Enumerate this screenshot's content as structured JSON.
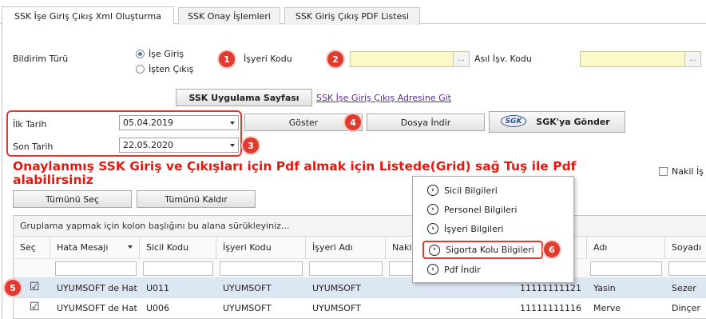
{
  "tabs": [
    {
      "label": "SSK İşe Giriş Çıkış Xml Oluşturma",
      "active": true
    },
    {
      "label": "SSK Onay İşlemleri",
      "active": false
    },
    {
      "label": "SSK Giriş Çıkış PDF Listesi",
      "active": false
    }
  ],
  "form": {
    "bildirim_label": "Bildirim Türü",
    "radio_ise_giris": "İşe Giriş",
    "radio_isten_cikis": "İşten Çıkış",
    "isyeri_kodu_label": "İşyeri Kodu",
    "asil_isv_kodu_label": "Asıl İşv. Kodu",
    "ellipsis": "...",
    "ssk_uygulama_button": "SSK Uygulama Sayfası",
    "ssk_adres_link": "SSK İşe Giriş Çıkış Adresine Git",
    "ilk_tarih_label": "İlk Tarih",
    "ilk_tarih_value": "05.04.2019",
    "son_tarih_label": "Son Tarih",
    "son_tarih_value": "22.05.2020",
    "goster_button": "Göster",
    "dosya_indir_button": "Dosya İndir",
    "sgk_logo": "SGK",
    "sgk_gonder_button": "SGK'ya Gönder"
  },
  "badges": [
    "1",
    "2",
    "3",
    "4",
    "5",
    "6"
  ],
  "notice": {
    "line1": "Onaylanmış SSK Giriş ve Çıkışları için Pdf almak için Listede(Grid) sağ Tuş ile Pdf",
    "line2": "alabilirsiniz"
  },
  "nakil_checkbox_label": "Nakil İş",
  "toolbar": {
    "select_all": "Tümünü Seç",
    "deselect_all": "Tümünü Kaldır"
  },
  "grid": {
    "group_hint": "Gruplama yapmak için kolon başlığını bu alana sürükleyiniz...",
    "columns": [
      "Seç",
      "Hata Mesajı",
      "Sicil Kodu",
      "İşyeri Kodu",
      "İşyeri Adı",
      "Nakil",
      "",
      "Adı",
      "Soyadı"
    ],
    "rows": [
      {
        "checked": true,
        "hata": "UYUMSOFT de Hat",
        "sicil": "U011",
        "isyeri_kodu": "UYUMSOFT",
        "isyeri_adi": "UYUMSOFT",
        "tc": "11111111121",
        "adi": "Yasin",
        "soyadi": "Sezer"
      },
      {
        "checked": true,
        "hata": "UYUMSOFT de Hat",
        "sicil": "U006",
        "isyeri_kodu": "UYUMSOFT",
        "isyeri_adi": "UYUMSOFT",
        "tc": "11111111116",
        "adi": "Merve",
        "soyadi": "Dinçer"
      }
    ]
  },
  "context_menu": {
    "items": [
      "Sicil Bilgileri",
      "Personel Bilgileri",
      "İşyeri Bilgileri",
      "Sigorta Kolu Bilgileri",
      "Pdf İndir"
    ],
    "highlighted": "Sigorta Kolu Bilgileri"
  },
  "colors": {
    "accent_red": "#e13a2f",
    "notice_red": "#e1190f",
    "yellow_input": "#fbf9c8",
    "selected_row": "#dde6f3",
    "link_purple": "#5a2d91"
  }
}
